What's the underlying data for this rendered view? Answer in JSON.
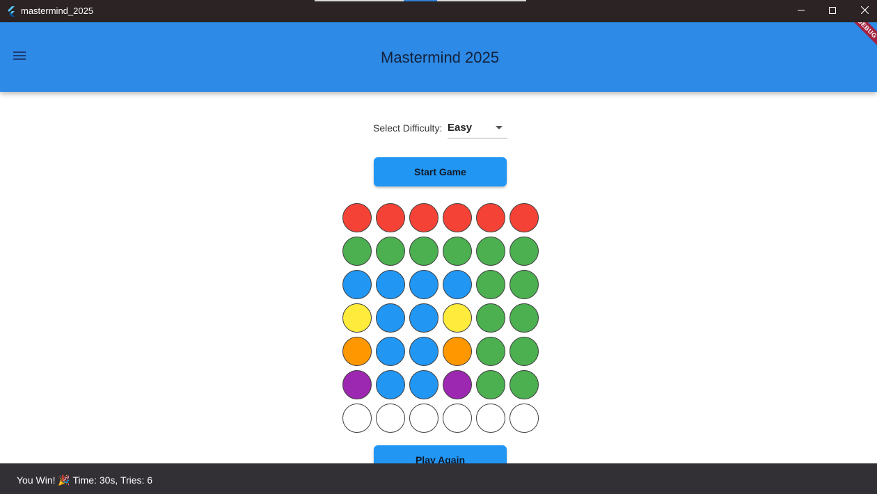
{
  "window": {
    "title": "mastermind_2025",
    "app_icon": "flutter-logo-icon",
    "controls": [
      "minimize-icon",
      "maximize-icon",
      "close-icon"
    ]
  },
  "appbar": {
    "title": "Mastermind 2025",
    "menu_icon": "menu-icon",
    "debug_banner": "DEBUG",
    "background": "#2d8ae6"
  },
  "difficulty": {
    "label": "Select Difficulty:",
    "selected": "Easy"
  },
  "buttons": {
    "start": "Start Game",
    "play_again": "Play Again",
    "color": "#2196f3"
  },
  "peg_colors": {
    "red": "#f44336",
    "green": "#4caf50",
    "blue": "#2196f3",
    "yellow": "#ffeb3b",
    "orange": "#ff9800",
    "purple": "#9c27b0",
    "empty": "#ffffff"
  },
  "board": {
    "rows": [
      [
        "red",
        "red",
        "red",
        "red",
        "red",
        "red"
      ],
      [
        "green",
        "green",
        "green",
        "green",
        "green",
        "green"
      ],
      [
        "blue",
        "blue",
        "blue",
        "blue",
        "green",
        "green"
      ],
      [
        "yellow",
        "blue",
        "blue",
        "yellow",
        "green",
        "green"
      ],
      [
        "orange",
        "blue",
        "blue",
        "orange",
        "green",
        "green"
      ],
      [
        "purple",
        "blue",
        "blue",
        "purple",
        "green",
        "green"
      ],
      [
        "empty",
        "empty",
        "empty",
        "empty",
        "empty",
        "empty"
      ]
    ]
  },
  "snackbar": {
    "message": "You Win! 🎉 Time: 30s, Tries: 6"
  }
}
